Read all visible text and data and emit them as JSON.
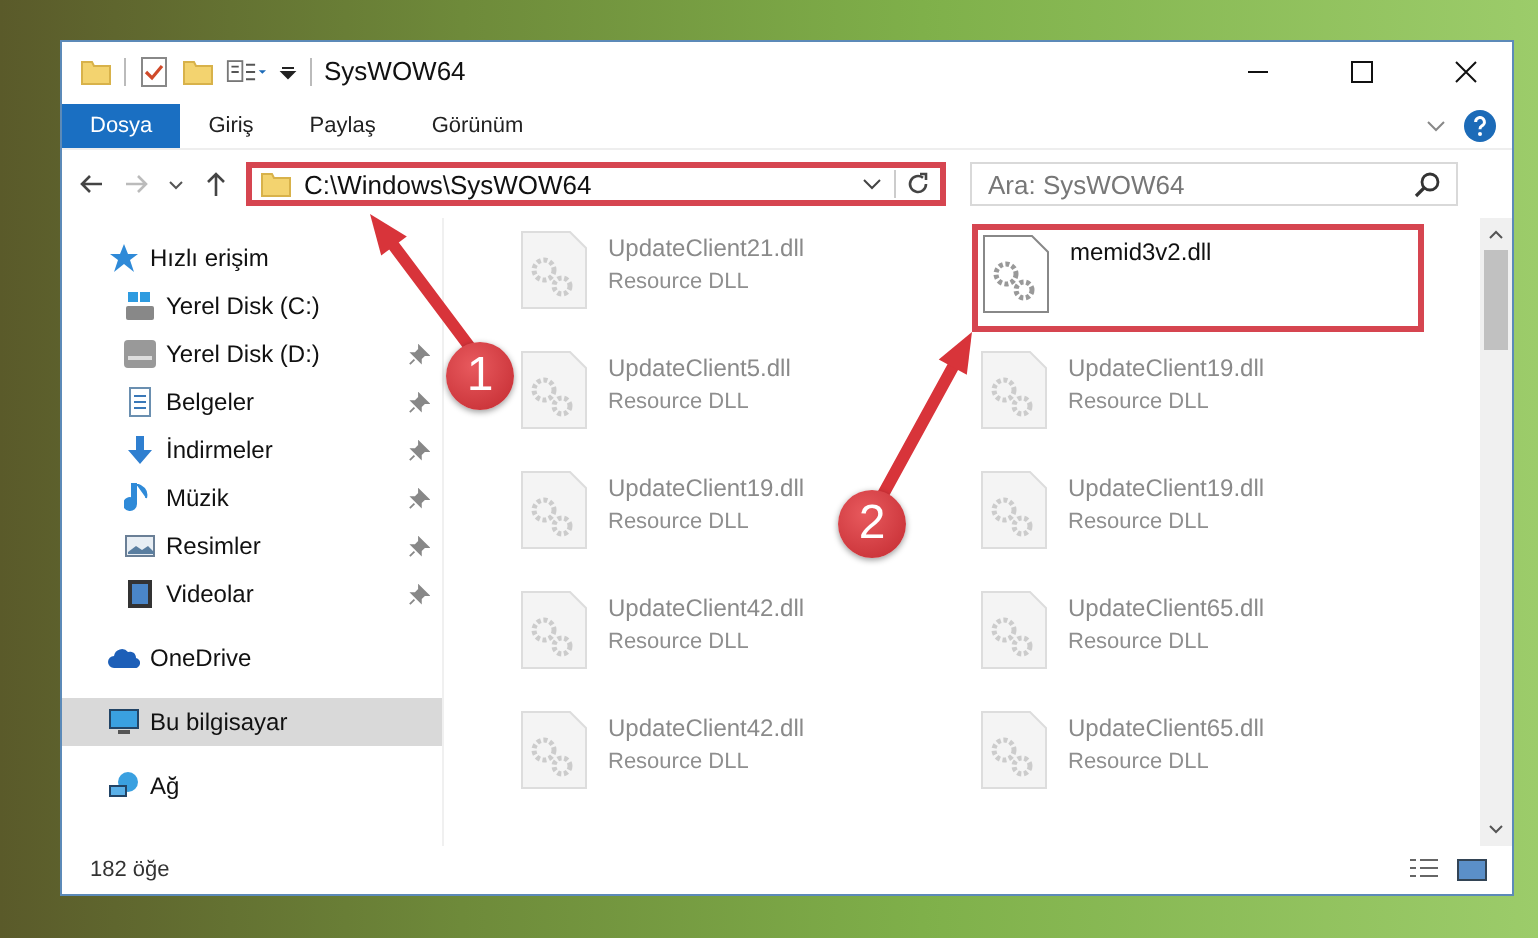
{
  "window": {
    "title": "SysWOW64"
  },
  "ribbon_tabs": [
    {
      "label": "Dosya",
      "selected": true
    },
    {
      "label": "Giriş",
      "selected": false
    },
    {
      "label": "Paylaş",
      "selected": false
    },
    {
      "label": "Görünüm",
      "selected": false
    }
  ],
  "address": {
    "path": "C:\\Windows\\SysWOW64",
    "highlighted": true
  },
  "search": {
    "placeholder": "Ara: SysWOW64"
  },
  "sidebar": {
    "items": [
      {
        "label": "Hızlı erişim",
        "kind": "star",
        "pinned": false,
        "selected": false,
        "children": [
          {
            "label": "Yerel Disk (C:)",
            "kind": "drive-c",
            "pinned": false,
            "selected": false
          },
          {
            "label": "Yerel Disk (D:)",
            "kind": "drive",
            "pinned": true,
            "selected": false
          },
          {
            "label": "Belgeler",
            "kind": "document",
            "pinned": true,
            "selected": false
          },
          {
            "label": "İndirmeler",
            "kind": "download",
            "pinned": true,
            "selected": false
          },
          {
            "label": "Müzik",
            "kind": "music",
            "pinned": true,
            "selected": false
          },
          {
            "label": "Resimler",
            "kind": "picture",
            "pinned": true,
            "selected": false
          },
          {
            "label": "Videolar",
            "kind": "video",
            "pinned": true,
            "selected": false
          }
        ]
      },
      {
        "label": "OneDrive",
        "kind": "cloud",
        "pinned": false,
        "selected": false
      },
      {
        "label": "Bu bilgisayar",
        "kind": "computer",
        "pinned": false,
        "selected": true
      },
      {
        "label": "Ağ",
        "kind": "network",
        "pinned": false,
        "selected": false
      }
    ]
  },
  "files": [
    {
      "name": "UpdateClient21.dll",
      "type": "Resource DLL",
      "dimmed": true,
      "highlighted": false
    },
    {
      "name": "memid3v2.dll",
      "dimmed": false,
      "highlighted": true
    },
    {
      "name": "UpdateClient5.dll",
      "type": "Resource DLL",
      "dimmed": true,
      "highlighted": false
    },
    {
      "name": "UpdateClient19.dll",
      "type": "Resource DLL",
      "dimmed": true,
      "highlighted": false
    },
    {
      "name": "UpdateClient19.dll",
      "type": "Resource DLL",
      "dimmed": true,
      "highlighted": false
    },
    {
      "name": "UpdateClient19.dll",
      "type": "Resource DLL",
      "dimmed": true,
      "highlighted": false
    },
    {
      "name": "UpdateClient42.dll",
      "type": "Resource DLL",
      "dimmed": true,
      "highlighted": false
    },
    {
      "name": "UpdateClient65.dll",
      "type": "Resource DLL",
      "dimmed": true,
      "highlighted": false
    },
    {
      "name": "UpdateClient42.dll",
      "type": "Resource DLL",
      "dimmed": true,
      "highlighted": false
    },
    {
      "name": "UpdateClient65.dll",
      "type": "Resource DLL",
      "dimmed": true,
      "highlighted": false
    }
  ],
  "status_bar": {
    "count": "182 öğe"
  },
  "annotations": [
    {
      "number": "1"
    },
    {
      "number": "2"
    }
  ]
}
